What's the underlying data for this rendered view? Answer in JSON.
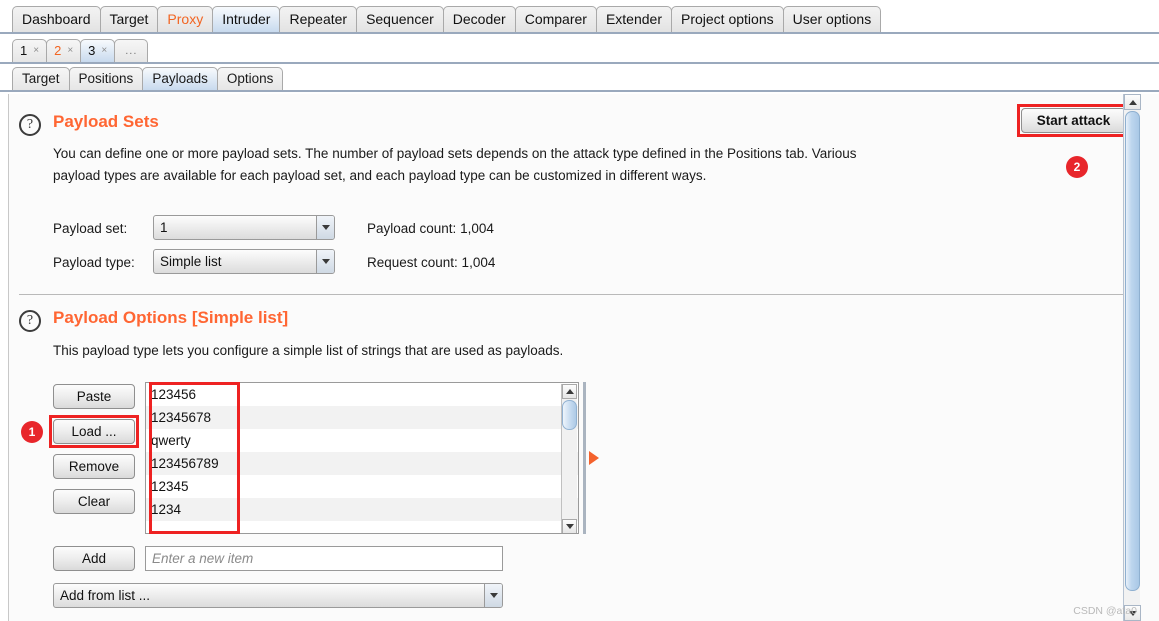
{
  "main_tabs": [
    {
      "label": "Dashboard",
      "state": "normal"
    },
    {
      "label": "Target",
      "state": "normal"
    },
    {
      "label": "Proxy",
      "state": "active-orange"
    },
    {
      "label": "Intruder",
      "state": "selected"
    },
    {
      "label": "Repeater",
      "state": "normal"
    },
    {
      "label": "Sequencer",
      "state": "normal"
    },
    {
      "label": "Decoder",
      "state": "normal"
    },
    {
      "label": "Comparer",
      "state": "normal"
    },
    {
      "label": "Extender",
      "state": "normal"
    },
    {
      "label": "Project options",
      "state": "normal"
    },
    {
      "label": "User options",
      "state": "normal"
    }
  ],
  "attack_tabs": [
    {
      "label": "1",
      "close": "×",
      "state": "normal"
    },
    {
      "label": "2",
      "close": "×",
      "state": "orange"
    },
    {
      "label": "3",
      "close": "×",
      "state": "selected"
    },
    {
      "label": "...",
      "close": "",
      "state": "dots"
    }
  ],
  "sub_tabs": [
    {
      "label": "Target",
      "state": "normal"
    },
    {
      "label": "Positions",
      "state": "normal"
    },
    {
      "label": "Payloads",
      "state": "selected"
    },
    {
      "label": "Options",
      "state": "normal"
    }
  ],
  "payload_sets": {
    "help_glyph": "?",
    "title": "Payload Sets",
    "desc_line1": "You can define one or more payload sets. The number of payload sets depends on the attack type defined in the Positions tab. Various",
    "desc_line2": "payload types are available for each payload set, and each payload type can be customized in different ways.",
    "payload_set_label": "Payload set:",
    "payload_set_value": "1",
    "payload_type_label": "Payload type:",
    "payload_type_value": "Simple list",
    "payload_count_label": "Payload count:  1,004",
    "request_count_label": "Request count:  1,004"
  },
  "payload_options": {
    "help_glyph": "?",
    "title": "Payload Options [Simple list]",
    "desc": "This payload type lets you configure a simple list of strings that are used as payloads.",
    "buttons": {
      "paste": "Paste",
      "load": "Load ...",
      "remove": "Remove",
      "clear": "Clear",
      "add": "Add"
    },
    "list_items": [
      "123456",
      "12345678",
      "qwerty",
      "123456789",
      "12345",
      "1234"
    ],
    "new_item_placeholder": "Enter a new item",
    "add_from_list_value": "Add from list ..."
  },
  "toolbar": {
    "start_attack_label": "Start attack"
  },
  "annotations": {
    "badge_one": "1",
    "badge_two": "2"
  },
  "watermark": "CSDN @ata0",
  "colors": {
    "accent_orange": "#ff6633",
    "annotation_red": "#ee2222",
    "badge_red": "#e8262b",
    "tab_selected_blue": "#c8daee"
  }
}
